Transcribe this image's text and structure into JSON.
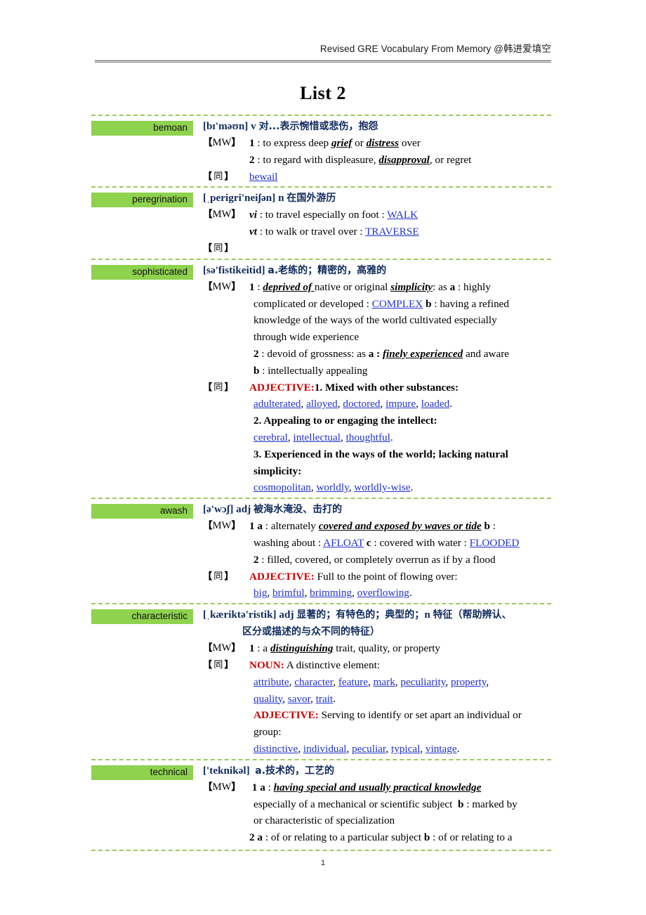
{
  "header": {
    "text": "Revised GRE Vocabulary From Memory @韩进爱填空"
  },
  "title": "List 2",
  "footer": {
    "page_number": "1"
  },
  "labels": {
    "mw_tag_open": "【",
    "mw_tag_text": "MW",
    "mw_tag_close": "】",
    "syn_tag_open": "【",
    "syn_tag_text": "同",
    "syn_tag_close": "】"
  },
  "colors": {
    "chip_green": "#8ed24e",
    "dash_green": "#9ccb5c",
    "headword_navy": "#102a5c",
    "link_blue": "#2233cc",
    "pos_red": "#cc0000"
  },
  "entries": [
    {
      "word": "bemoan",
      "phonetic": "[bɪ'məʊn]",
      "pos": "v",
      "chinese": "对...表示惋惜或悲伤，抱怨",
      "mw": [
        {
          "num": "1",
          "sep": " : ",
          "text": "to express deep grief or distress over"
        },
        {
          "num": "2",
          "sep": " : ",
          "text": "to regard with displeasure, disapproval, or regret"
        }
      ],
      "syn": [
        "bewail"
      ]
    },
    {
      "word": "peregrination",
      "phonetic": "[ˌperigri'neiʃən]",
      "pos": "n",
      "chinese": "在国外游历",
      "mw": [
        {
          "num": "vi",
          "sep": " : ",
          "text": "to travel especially on foot : WALK"
        },
        {
          "num": "vt",
          "sep": " : ",
          "text": "to walk or travel over : TRAVERSE"
        }
      ],
      "syn": []
    },
    {
      "word": "sophisticated",
      "phonetic": "[sə'fistikeitid]",
      "pos": "a.",
      "chinese": "老练的；精密的，高雅的",
      "mw": [
        {
          "num": "1",
          "sep": " : ",
          "text": "deprived of native or original simplicity: as a : highly complicated or developed : COMPLEX b : having a refined knowledge of the ways of the world cultivated especially through wide experience"
        },
        {
          "num": "2",
          "sep": " : ",
          "text": "devoid of grossness: as a : finely experienced and aware b : intellectually appealing"
        }
      ],
      "syn_groups": [
        {
          "pos": "ADJECTIVE:",
          "sense": "1. Mixed with other substances:",
          "words": [
            "adulterated",
            "alloyed",
            "doctored",
            "impure",
            "loaded"
          ]
        },
        {
          "pos": "",
          "sense": "2. Appealing to or engaging the intellect:",
          "words": [
            "cerebral",
            "intellectual",
            "thoughtful"
          ]
        },
        {
          "pos": "",
          "sense": "3. Experienced in the ways of the world; lacking natural simplicity:",
          "words": [
            "cosmopolitan",
            "worldly",
            "worldly-wise"
          ]
        }
      ]
    },
    {
      "word": "awash",
      "phonetic": "[ə'wɔʃ]",
      "pos": "adj",
      "chinese": "被海水淹没、击打的",
      "mw": [
        {
          "num": "1 a",
          "sep": " : ",
          "text": "alternately covered and exposed by waves or tide b : washing about : AFLOAT c : covered with water : FLOODED"
        },
        {
          "num": "2",
          "sep": " : ",
          "text": "filled, covered, or completely overrun as if by a flood"
        }
      ],
      "syn_groups": [
        {
          "pos": "ADJECTIVE:",
          "sense": "Full to the point of flowing over:",
          "words": [
            "big",
            "brimful",
            "brimming",
            "overflowing"
          ]
        }
      ]
    },
    {
      "word": "characteristic",
      "phonetic": "[ˌkæriktə'ristik]",
      "pos": "adj",
      "chinese": "显著的；有特色的；典型的；",
      "pos2": "n",
      "chinese2": "特征（帮助辨认、",
      "chinese_line2": "区分或描述的与众不同的特征）",
      "mw": [
        {
          "num": "1",
          "sep": " : ",
          "text": "a distinguishing trait, quality, or property"
        }
      ],
      "syn_groups": [
        {
          "pos": "NOUN:",
          "sense": "A distinctive element:",
          "words": [
            "attribute",
            "character",
            "feature",
            "mark",
            "peculiarity",
            "property",
            "quality",
            "savor",
            "trait"
          ]
        },
        {
          "pos": "ADJECTIVE:",
          "sense": "Serving to identify or set apart an individual or group:",
          "words": [
            "distinctive",
            "individual",
            "peculiar",
            "typical",
            "vintage"
          ]
        }
      ]
    },
    {
      "word": "technical",
      "phonetic": "['teknikəl]",
      "pos": "a.",
      "chinese": "技术的，工艺的",
      "mw": [
        {
          "num": "1 a",
          "sep": " : ",
          "text": "having special and usually practical knowledge especially of a mechanical or scientific subject b : marked by or characteristic of specialization"
        },
        {
          "num": "2 a",
          "sep": " : ",
          "text": "of or relating to a particular subject b : of or relating to a"
        }
      ],
      "syn": []
    }
  ],
  "text_fragments": {
    "bemoan_1_pre": "to express deep ",
    "bemoan_1_bi1": "grief",
    "bemoan_1_mid": " or ",
    "bemoan_1_bi2": "distress",
    "bemoan_1_post": " over",
    "bemoan_2_pre": "to regard with displeasure, ",
    "bemoan_2_bi": "disapproval",
    "bemoan_2_post": ", or regret",
    "bemoan_syn": "bewail",
    "pereg_vi_pre": "to travel especially on foot : ",
    "pereg_vi_link": "WALK",
    "pereg_vt_pre": "to walk or travel over : ",
    "pereg_vt_link": "TRAVERSE",
    "soph_1_bi1": "deprived of ",
    "soph_1_a": "native or original ",
    "soph_1_bi2": "simplicity",
    "soph_1_b": ": as ",
    "soph_1_bold_a": "a",
    "soph_1_c": " : highly",
    "soph_1_l2a": "complicated or developed : ",
    "soph_1_l2link": "COMPLEX",
    "soph_1_bold_b": "b",
    "soph_1_l2c": " : having a refined",
    "soph_1_l3": "knowledge of the ways of the world cultivated especially",
    "soph_1_l4": "through wide experience",
    "soph_2_a": "devoid of grossness: as ",
    "soph_2_bold_a": "a :",
    "soph_2_bi": "finely experienced",
    "soph_2_c": " and aware",
    "soph_2_bold_b": "b",
    "soph_2_d": " : intellectually appealing",
    "awash_1_pre": "alternately ",
    "awash_1_bi": "covered and exposed by waves or tide",
    "awash_1_b": "b",
    "awash_1_colon": " :",
    "awash_1_l2a": "washing about : ",
    "awash_1_l2link": "AFLOAT",
    "awash_1_l2c": "c",
    "awash_1_l2d": " : covered with water : ",
    "awash_1_l2link2": "FLOODED",
    "awash_2": "filled, covered, or completely overrun as if by a flood",
    "char_1_pre": "a ",
    "char_1_bi": "distinguishing",
    "char_1_post": " trait, quality, or property",
    "tech_1_bi": "having special and usually practical knowledge",
    "tech_1_l2a": "especially of a mechanical or scientific subject",
    "tech_1_l2b": "b",
    "tech_1_l2c": " : marked by",
    "tech_1_l3": "or characteristic of specialization",
    "tech_2_pre": "of or relating to a particular subject ",
    "tech_2_b": "b",
    "tech_2_post": " : of or relating to a"
  }
}
